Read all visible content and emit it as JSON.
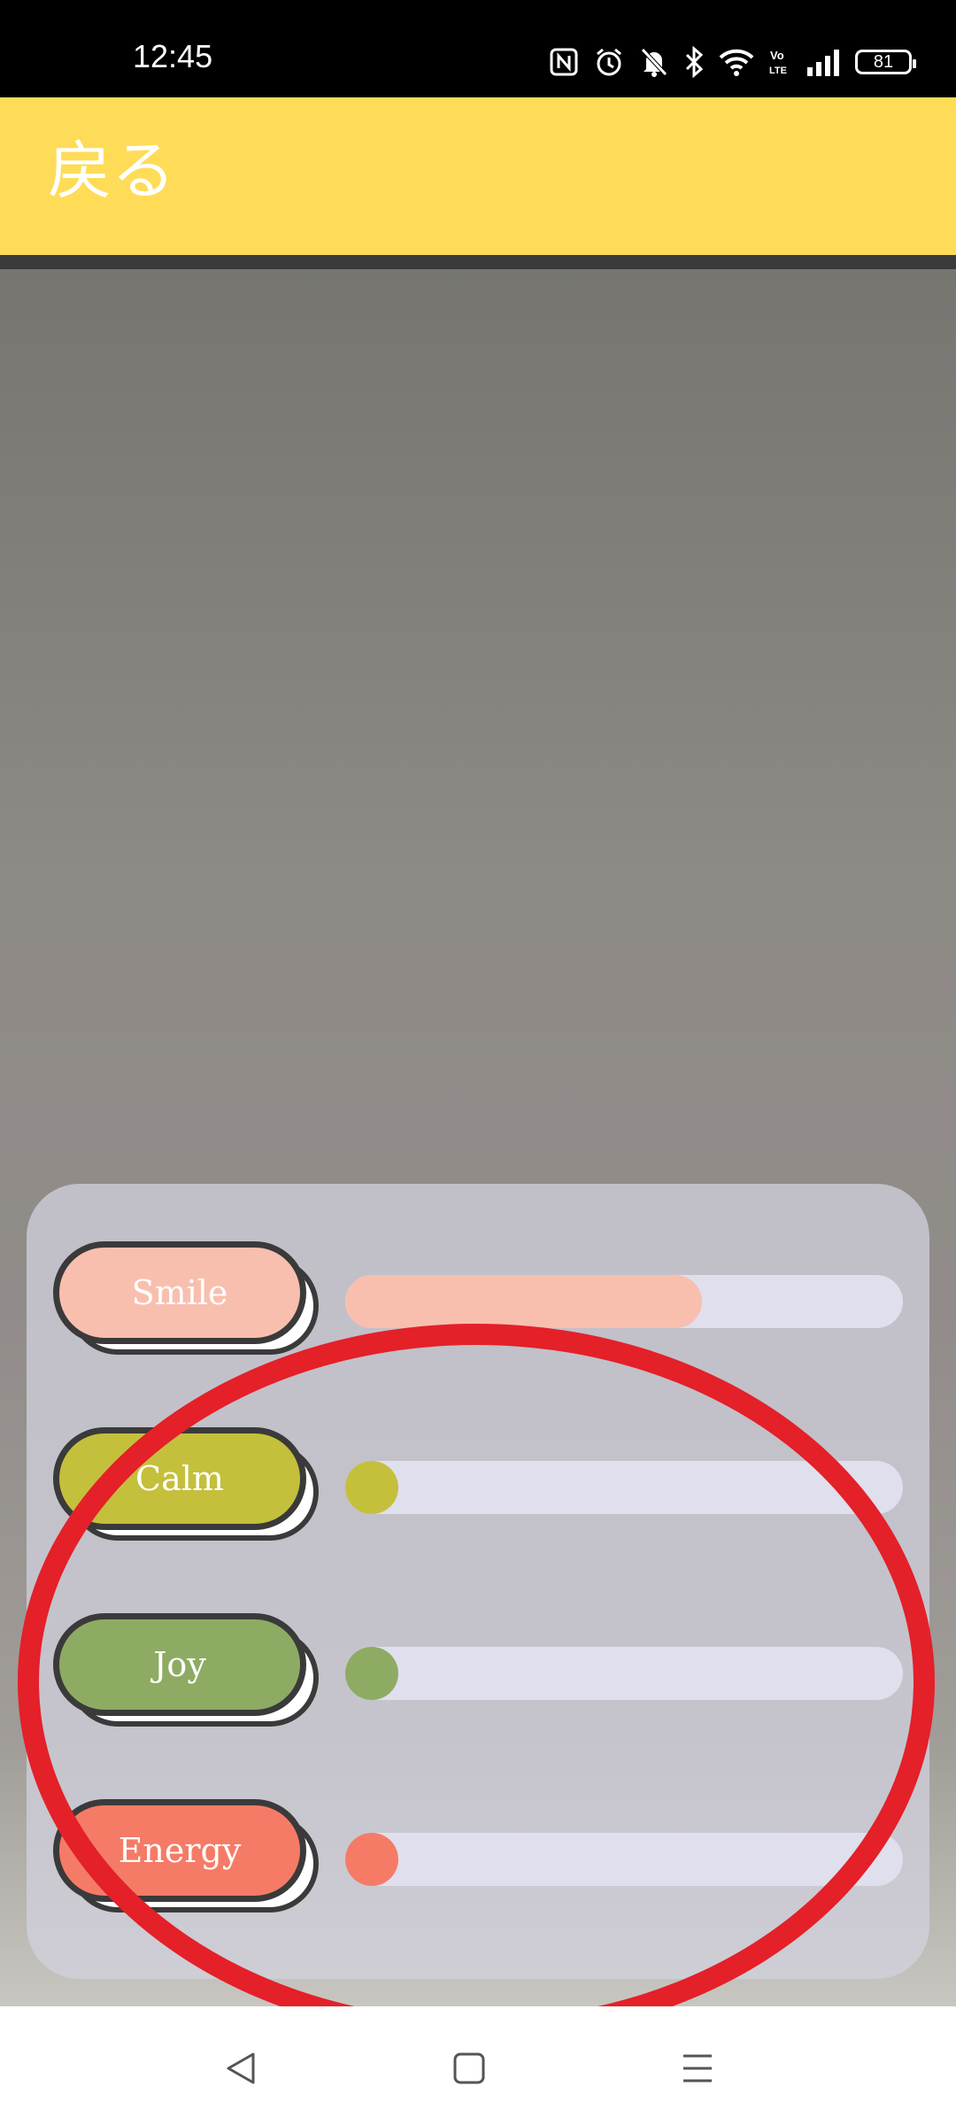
{
  "status_bar": {
    "time": "12:45",
    "battery_level": "81",
    "icons": [
      "nfc-icon",
      "alarm-icon",
      "mute-icon",
      "bluetooth-icon",
      "wifi-icon",
      "volte-icon",
      "signal-icon",
      "battery-icon"
    ]
  },
  "app_bar": {
    "back_label": "戻る",
    "color": "#FEDC57"
  },
  "moods": [
    {
      "label": "Smile",
      "color": "#F8BFAF",
      "level": 0.64
    },
    {
      "label": "Calm",
      "color": "#C4C03C",
      "level": 0.0
    },
    {
      "label": "Joy",
      "color": "#8EAB63",
      "level": 0.0
    },
    {
      "label": "Energy",
      "color": "#F57B67",
      "level": 0.0
    }
  ],
  "nav_bar": {
    "icons": [
      "back-triangle-icon",
      "home-square-icon",
      "menu-lines-icon"
    ]
  }
}
